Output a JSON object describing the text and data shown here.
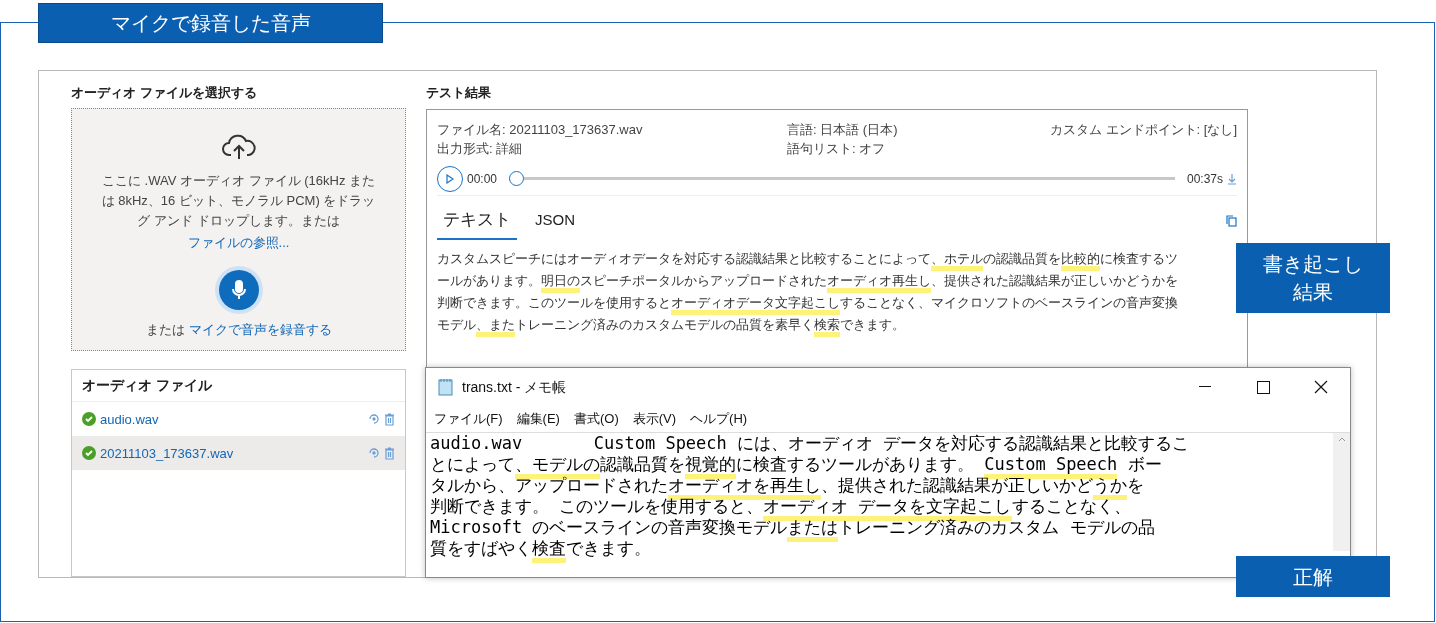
{
  "banner": {
    "title": "マイクで録音した音声"
  },
  "select": {
    "heading": "オーディオ ファイルを選択する",
    "drop_text": "ここに .WAV オーディオ ファイル (16kHz または 8kHz、16 ビット、モノラル PCM) をドラッグ アンド ドロップします。または",
    "browse_link": "ファイルの参照...",
    "record_prefix": "または",
    "record_link": "マイクで音声を録音する"
  },
  "files": {
    "heading": "オーディオ ファイル",
    "items": [
      {
        "name": "audio.wav",
        "selected": false
      },
      {
        "name": "20211103_173637.wav",
        "selected": true
      }
    ]
  },
  "results": {
    "heading": "テスト結果",
    "meta": [
      "ファイル名: 20211103_173637.wav",
      "言語: 日本語 (日本)",
      "カスタム エンドポイント: [なし]",
      "出力形式: 詳細",
      "語句リスト: オフ"
    ],
    "player": {
      "start": "00:00",
      "end": "00:37s",
      "level": 0
    },
    "tabs": [
      {
        "label": "テキスト",
        "selected": true
      },
      {
        "label": "JSON",
        "selected": false
      }
    ],
    "lines": [
      [
        {
          "text": "カスタムスピーチにはオーディオデータを対応する認識結果と比較することによって",
          "highlighted": false
        },
        {
          "text": "、ホテル",
          "highlighted": true
        },
        {
          "text": "の認識品質を",
          "highlighted": false
        },
        {
          "text": "比較的",
          "highlighted": true
        },
        {
          "text": "に検査するツ",
          "highlighted": false
        }
      ],
      [
        {
          "text": "ールがあります。",
          "highlighted": false
        },
        {
          "text": "明日の",
          "highlighted": true
        },
        {
          "text": "スピーチポータルからアップロードされた",
          "highlighted": false
        },
        {
          "text": "オーディオ再生し",
          "highlighted": true
        },
        {
          "text": "、提供された認識結果が正しいかどうかを",
          "highlighted": false
        }
      ],
      [
        {
          "text": "判断できます。このツールを使用すると",
          "highlighted": false
        },
        {
          "text": "オーディオデータ文字起こし",
          "highlighted": true
        },
        {
          "text": "することなく、マイクロソフトのベースラインの音声変換",
          "highlighted": false
        }
      ],
      [
        {
          "text": "モデル",
          "highlighted": false
        },
        {
          "text": "、また",
          "highlighted": true
        },
        {
          "text": "トレーニング済みのカスタムモデルの品質を素早く",
          "highlighted": false
        },
        {
          "text": "検索",
          "highlighted": true
        },
        {
          "text": "できます。",
          "highlighted": false
        }
      ]
    ]
  },
  "notepad": {
    "title": "trans.txt - メモ帳",
    "menu": [
      "ファイル(F)",
      "編集(E)",
      "書式(O)",
      "表示(V)",
      "ヘルプ(H)"
    ],
    "lines": [
      [
        {
          "text": "audio.wav       Custom Speech には、オーディオ データを対応する認識結果と比較するこ",
          "highlighted": false
        }
      ],
      [
        {
          "text": "とによって",
          "highlighted": false
        },
        {
          "text": "、モデルの",
          "highlighted": true
        },
        {
          "text": "認識品質を",
          "highlighted": false
        },
        {
          "text": "視覚的",
          "highlighted": true
        },
        {
          "text": "に検査するツールがあります。 ",
          "highlighted": false
        },
        {
          "text": "Custom Speech",
          "highlighted": true
        },
        {
          "text": " ボー",
          "highlighted": false
        }
      ],
      [
        {
          "text": "タルから、アップロードされた",
          "highlighted": false
        },
        {
          "text": "オーディオを再生し",
          "highlighted": true
        },
        {
          "text": "、提供された認識結果が正しいかど",
          "highlighted": false
        },
        {
          "text": "うか",
          "highlighted": true
        },
        {
          "text": "を",
          "highlighted": false
        }
      ],
      [
        {
          "text": "判断できます。 このツールを使用すると、",
          "highlighted": false
        },
        {
          "text": "オーディオ データを文字起こし",
          "highlighted": true
        },
        {
          "text": "することなく、",
          "highlighted": false
        }
      ],
      [
        {
          "text": "Microsoft のベースラインの音声変換モデル",
          "highlighted": false
        },
        {
          "text": "または",
          "highlighted": true
        },
        {
          "text": "トレーニング済みのカスタム モデルの品",
          "highlighted": false
        }
      ],
      [
        {
          "text": "質をすばやく",
          "highlighted": false
        },
        {
          "text": "検査",
          "highlighted": true
        },
        {
          "text": "できます。",
          "highlighted": false
        }
      ]
    ]
  },
  "callouts": [
    {
      "lines": [
        "書き起こし",
        "結果"
      ]
    },
    {
      "lines": [
        "正解"
      ]
    }
  ]
}
